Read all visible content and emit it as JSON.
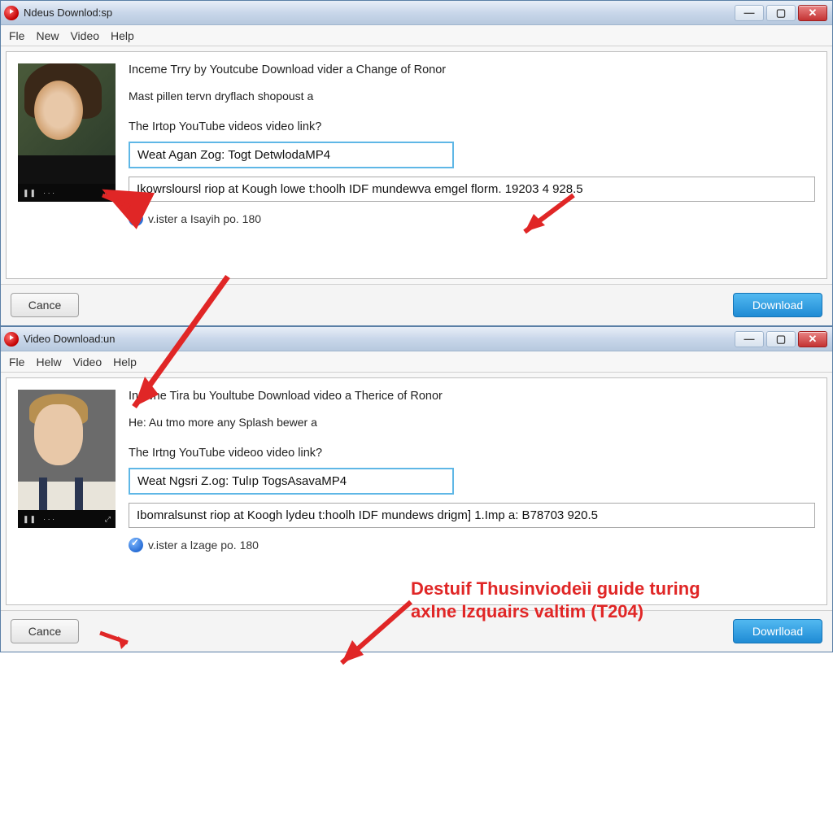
{
  "window1": {
    "title": "Ndeus Downlod:sp",
    "menu": [
      "Fle",
      "New",
      "Video",
      "Help"
    ],
    "heading": "Inceme Trry by Youtcube Download vider a Change of Ronor",
    "subheading": "Mast pillen tervn dryflach shopoust a",
    "prompt": "The Irtop YouTube videos video link?",
    "input1": "Weat Agan Zog: Togt DetwlodaMP4",
    "input2": "Ikowrsloursl riop at Kough lowe t:hoolh IDF mundewva emgel florm. 19203 4 928.5",
    "check": "v.ister a Isayih po. 180",
    "cancel": "Cance",
    "download": "Download"
  },
  "window2": {
    "title": "Video Download:un",
    "menu": [
      "Fle",
      "Helw",
      "Video",
      "Help"
    ],
    "heading": "Inowne Tira bu Youltube Download video a Therice of Ronor",
    "subheading": "He: Au tmo more any Splash bewer a",
    "prompt": "The Irtng YouTube videoo video link?",
    "input1": "Weat Ngsri Z.og: Tulıp TogsAsavaMP4",
    "input2": "Ibomralsunst riop at Koogh lydeu t:hoolh IDF mundews drigm] 1.Imp a: B78703 920.5",
    "check": "v.ister a lzage po. 180",
    "cancel": "Cance",
    "download": "Dowrlload"
  },
  "annotation": {
    "line1": "Destuif Thusinviodeìi guide turing",
    "line2": "axIne Izquairs valtim (T204)"
  },
  "win_controls": {
    "min": "—",
    "max": "▢",
    "close": "✕"
  }
}
